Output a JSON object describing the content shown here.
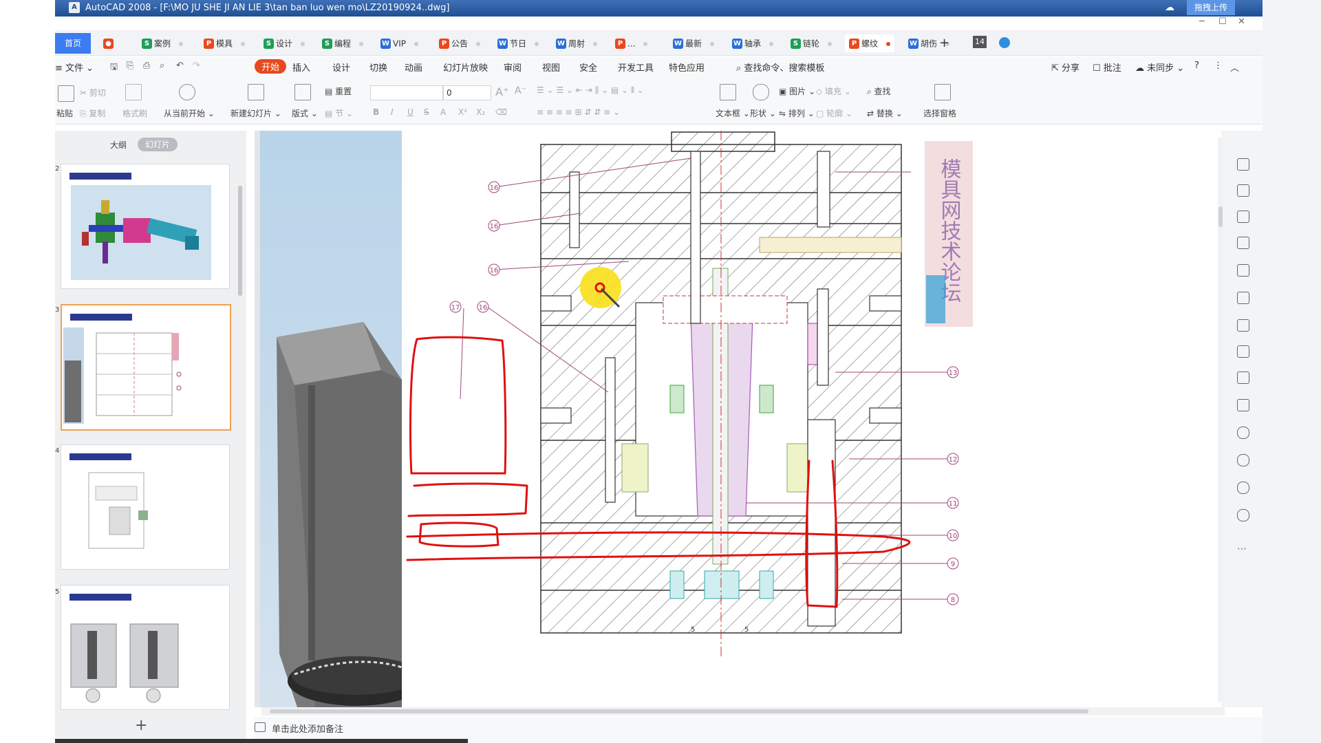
{
  "titlebar": {
    "app_icon": "autocad-icon",
    "title": "AutoCAD 2008 - [F:\\MO JU SHE JI AN LIE 3\\tan ban luo wen mo\\LZ20190924..dwg]",
    "upload_label": "拖拽上传"
  },
  "tabs": {
    "home": "首页",
    "items": [
      {
        "label": "案例",
        "type": "S",
        "color": "#1e9e56"
      },
      {
        "label": "模具",
        "type": "P",
        "color": "#e8491d"
      },
      {
        "label": "设计",
        "type": "S",
        "color": "#1e9e56"
      },
      {
        "label": "编程",
        "type": "S",
        "color": "#1e9e56"
      },
      {
        "label": "VIP",
        "type": "W",
        "color": "#2b6fd6"
      },
      {
        "label": "公告",
        "type": "P",
        "color": "#e8491d"
      },
      {
        "label": "节日",
        "type": "W",
        "color": "#2b6fd6"
      },
      {
        "label": "周射",
        "type": "W",
        "color": "#2b6fd6"
      },
      {
        "label": "...",
        "type": "P",
        "color": "#e8491d"
      },
      {
        "label": "最新",
        "type": "W",
        "color": "#2b6fd6"
      },
      {
        "label": "轴承",
        "type": "W",
        "color": "#2b6fd6"
      },
      {
        "label": "链轮",
        "type": "S",
        "color": "#1e9e56"
      },
      {
        "label": "螺纹",
        "type": "P",
        "color": "#e8491d"
      },
      {
        "label": "胡伤",
        "type": "W",
        "color": "#2b6fd6"
      }
    ],
    "tab_count": "14"
  },
  "menu": {
    "file": "文件",
    "items": [
      "开始",
      "插入",
      "设计",
      "切换",
      "动画",
      "幻灯片放映",
      "审阅",
      "视图",
      "安全",
      "开发工具",
      "特色应用"
    ],
    "search": "查找命令、搜索模板",
    "share": "分享",
    "comment": "批注",
    "sync": "未同步"
  },
  "ribbon": {
    "paste": "粘贴",
    "cut": "剪切",
    "copy": "复制",
    "format_painter": "格式刷",
    "play_from_current": "从当前开始",
    "new_slide": "新建幻灯片",
    "layout": "版式",
    "reset": "重置",
    "section": "节",
    "font_size": "0",
    "text_box": "文本框",
    "shape": "形状",
    "picture": "图片",
    "fill": "填充",
    "arrange": "排列",
    "outline": "轮廓",
    "find": "查找",
    "replace": "替换",
    "select_pane": "选择窗格"
  },
  "sidebar": {
    "outline_label": "大纲",
    "slides_label": "幻灯片",
    "slide_numbers": [
      "2",
      "3",
      "4",
      "5"
    ]
  },
  "drawing": {
    "balloons_left": [
      "16",
      "16",
      "16",
      "17",
      "16"
    ],
    "balloons_right": [
      "13",
      "12",
      "11",
      "10",
      "9",
      "8"
    ],
    "watermark": "模具网技术论坛",
    "bottom_labels": [
      "5",
      "5"
    ],
    "cursor_label": "pen-cursor"
  },
  "notes": {
    "placeholder": "单击此处添加备注"
  }
}
